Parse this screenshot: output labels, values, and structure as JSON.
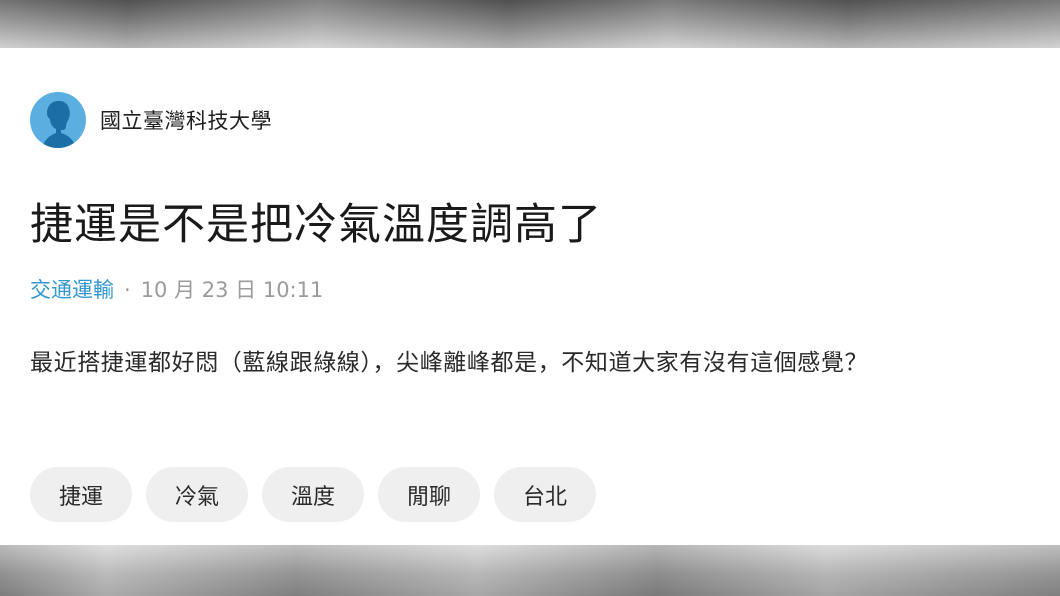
{
  "post": {
    "school": "國立臺灣科技大學",
    "title": "捷運是不是把冷氣溫度調高了",
    "forum": "交通運輸",
    "separator": "·",
    "datetime": "10 月 23 日 10:11",
    "content": "最近搭捷運都好悶（藍線跟綠線），尖峰離峰都是，不知道大家有沒有這個感覺？"
  },
  "tags": [
    "捷運",
    "冷氣",
    "溫度",
    "閒聊",
    "台北"
  ],
  "colors": {
    "avatar": "#5aaee0",
    "forum_link": "#3397cf",
    "meta": "#9b9b9b",
    "tag_bg": "#efefef"
  },
  "icons": {
    "avatar": "user-silhouette-icon"
  }
}
